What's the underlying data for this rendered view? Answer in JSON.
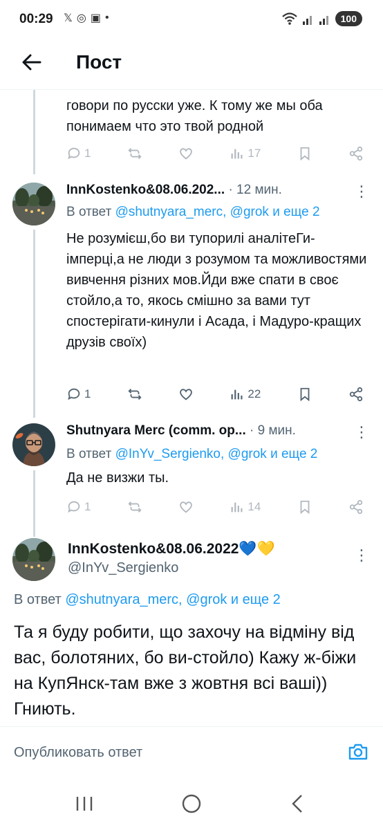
{
  "status_bar": {
    "time": "00:29",
    "left_icons": [
      "𝕏",
      "◎",
      "▣",
      "•"
    ],
    "battery": "100"
  },
  "header": {
    "title": "Пост"
  },
  "prev_post": {
    "text": "говори по русски уже. К тому же мы оба понимаем что это твой родной",
    "replies": "1",
    "views": "17"
  },
  "reply1": {
    "author": "InnKostenko&08.06.202...",
    "time": "· 12 мин.",
    "reply_prefix": "В ответ",
    "reply_mentions": "@shutnyara_merc, @grok",
    "reply_suffix": "и еще 2",
    "text": "Не розумієш,бо ви тупорилі аналітеГи-імперці,а не люди з розумом та можливостями вивчення різних мов.Йди вже спати в своє стойло,а то, якось смішно за вами тут спостерігати-кинули і Асада, і Мадуро-кращих друзів своїх)",
    "replies": "1",
    "views": "22"
  },
  "reply2": {
    "author": "Shutnyara Merc (comm. op...",
    "time": "· 9 мин.",
    "reply_prefix": "В ответ",
    "reply_mentions": "@InYv_Sergienko, @grok",
    "reply_suffix": "и еще 2",
    "text": "Да не визжи ты.",
    "replies": "1",
    "views": "14"
  },
  "main_post": {
    "author": "InnKostenko&08.06.2022💙💛",
    "handle": "@InYv_Sergienko",
    "reply_prefix": "В ответ",
    "reply_mentions": "@shutnyara_merc, @grok",
    "reply_suffix": "и еще 2",
    "text": "Та я буду робити, що захочу на відміну від вас, болотяних, бо ви-стойло) Кажу ж-біжи на КупЯнск-там вже з жовтня всі ваші)) Гниють."
  },
  "composer": {
    "placeholder": "Опубликовать ответ"
  },
  "colors": {
    "accent": "#1d9bf0",
    "secondary_text": "#536471",
    "thread_line": "#cfd9de"
  }
}
